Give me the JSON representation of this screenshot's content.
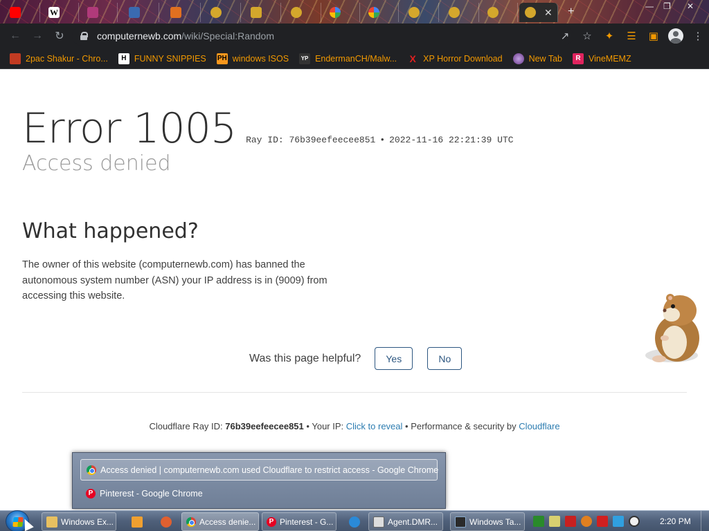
{
  "browser": {
    "active_tab": {
      "close": "✕"
    },
    "new_tab": "+",
    "url_host": "computernewb.com",
    "url_path": "/wiki/Special:Random",
    "bookmarks": [
      {
        "label": "2pac Shakur - Chro...",
        "icon": "2pac-bookmark-icon",
        "color": "#c23b22"
      },
      {
        "label": "FUNNY SNIPPIES",
        "icon": "h-bookmark-icon",
        "color": "#ffffff"
      },
      {
        "label": "windows ISOS",
        "icon": "pornhub-bookmark-icon",
        "color": "#f7971d"
      },
      {
        "label": "EndermanCH/Malw...",
        "icon": "yp-bookmark-icon",
        "color": "#555555"
      },
      {
        "label": "XP Horror Download",
        "icon": "x-bookmark-icon",
        "color": "#e02020"
      },
      {
        "label": "New Tab",
        "icon": "newtab-bookmark-icon",
        "color": "#9b59b6"
      },
      {
        "label": "VineMEMZ",
        "icon": "r-bookmark-icon",
        "color": "#e0245e"
      }
    ]
  },
  "page": {
    "error_code": "Error 1005",
    "ray_id_label": "Ray ID: 76b39eefeecee851",
    "bullet": "•",
    "timestamp": "2022-11-16 22:21:39 UTC",
    "subtitle": "Access denied",
    "what_happened_heading": "What happened?",
    "what_happened_body": "The owner of this website (computernewb.com) has banned the autonomous system number (ASN) your IP address is in (9009) from accessing this website.",
    "helpful_question": "Was this page helpful?",
    "yes_label": "Yes",
    "no_label": "No",
    "footer": {
      "ray_prefix": "Cloudflare Ray ID:",
      "ray_id": "76b39eefeecee851",
      "sep1": "•",
      "ip_prefix": "Your IP:",
      "ip_link": "Click to reveal",
      "sep2": "•",
      "perf_prefix": "Performance & security by",
      "perf_link": "Cloudflare"
    }
  },
  "preview": {
    "items": [
      "Access denied | computernewb.com used Cloudflare to restrict access - Google Chrome",
      "Pinterest - Google Chrome"
    ]
  },
  "taskbar": {
    "buttons": [
      {
        "label": "Windows Ex..."
      },
      {
        "label": "Access denie..."
      },
      {
        "label": "Pinterest - G..."
      },
      {
        "label": "Agent.DMR..."
      },
      {
        "label": "Windows Ta..."
      }
    ],
    "clock": "2:20 PM"
  },
  "colors": {
    "link": "#2c7cb0",
    "button_border": "#2c5680",
    "bookmark_text": "#f29900"
  }
}
